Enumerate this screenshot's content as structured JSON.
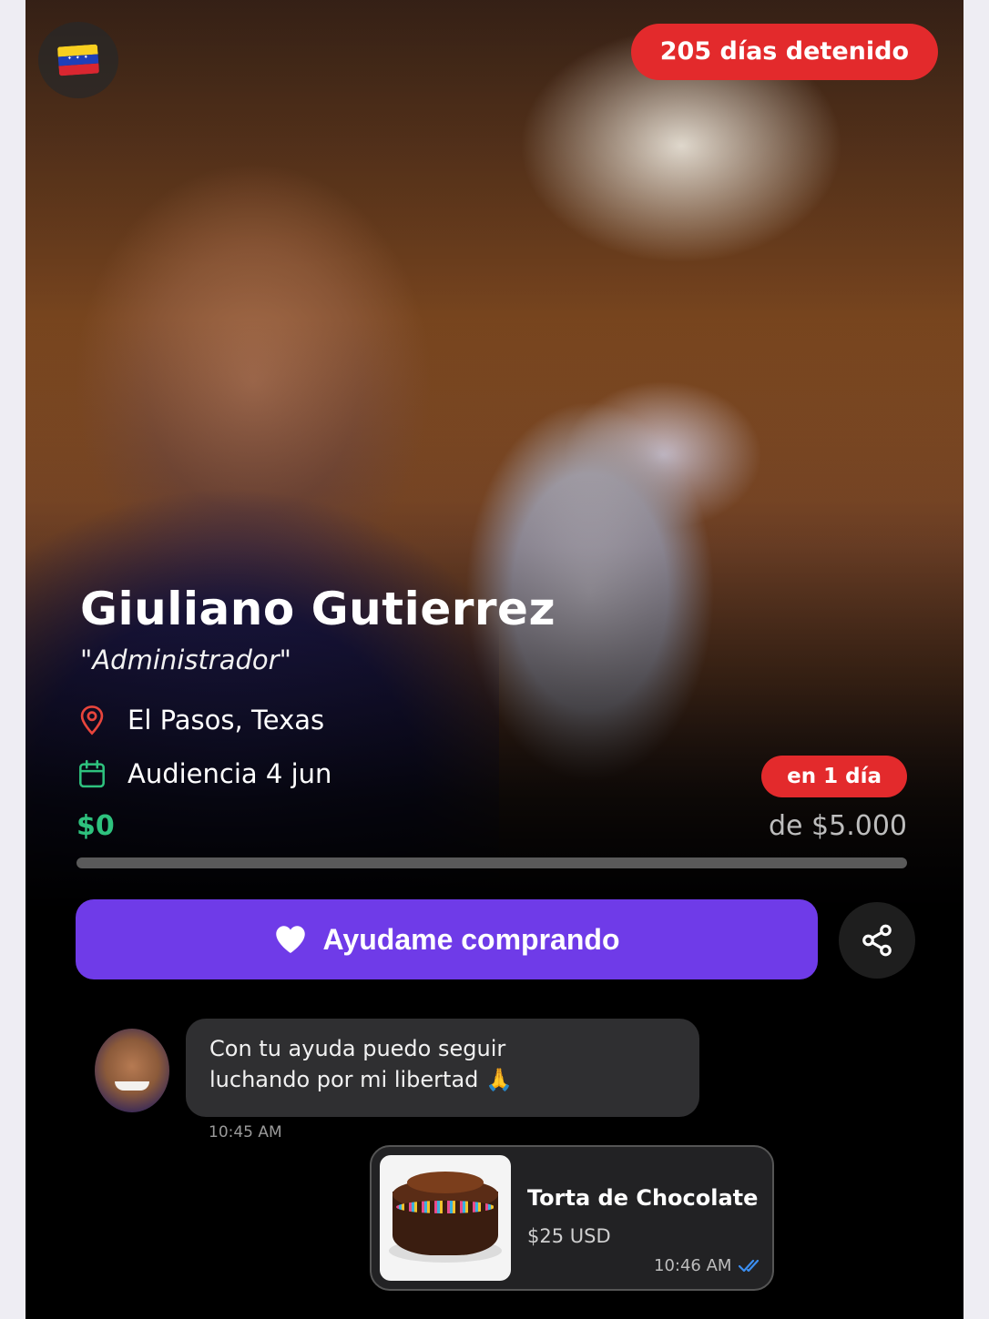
{
  "header": {
    "days_detained": "205 días detenido",
    "flag_icon": "venezuela-flag-icon"
  },
  "profile": {
    "name": "Giuliano Gutierrez",
    "role": "\"Administrador\"",
    "location": "El Pasos, Texas",
    "hearing": "Audiencia 4 jun",
    "hearing_badge": "en 1 día"
  },
  "funding": {
    "raised": "$0",
    "goal": "de $5.000",
    "progress_fraction": 0,
    "accent_color": "#2ec27e"
  },
  "actions": {
    "cta_label": "Ayudame comprando",
    "cta_color": "#6f3be8",
    "share_icon": "share-icon"
  },
  "chat": {
    "message_line1": "Con tu ayuda puedo seguir",
    "message_line2": "luchando por mi libertad 🙏",
    "message_time": "10:45 AM",
    "product_name": "Torta de Chocolate",
    "product_price": "$25 USD",
    "product_time": "10:46 AM"
  },
  "colors": {
    "badge_red": "#e32a2c"
  }
}
